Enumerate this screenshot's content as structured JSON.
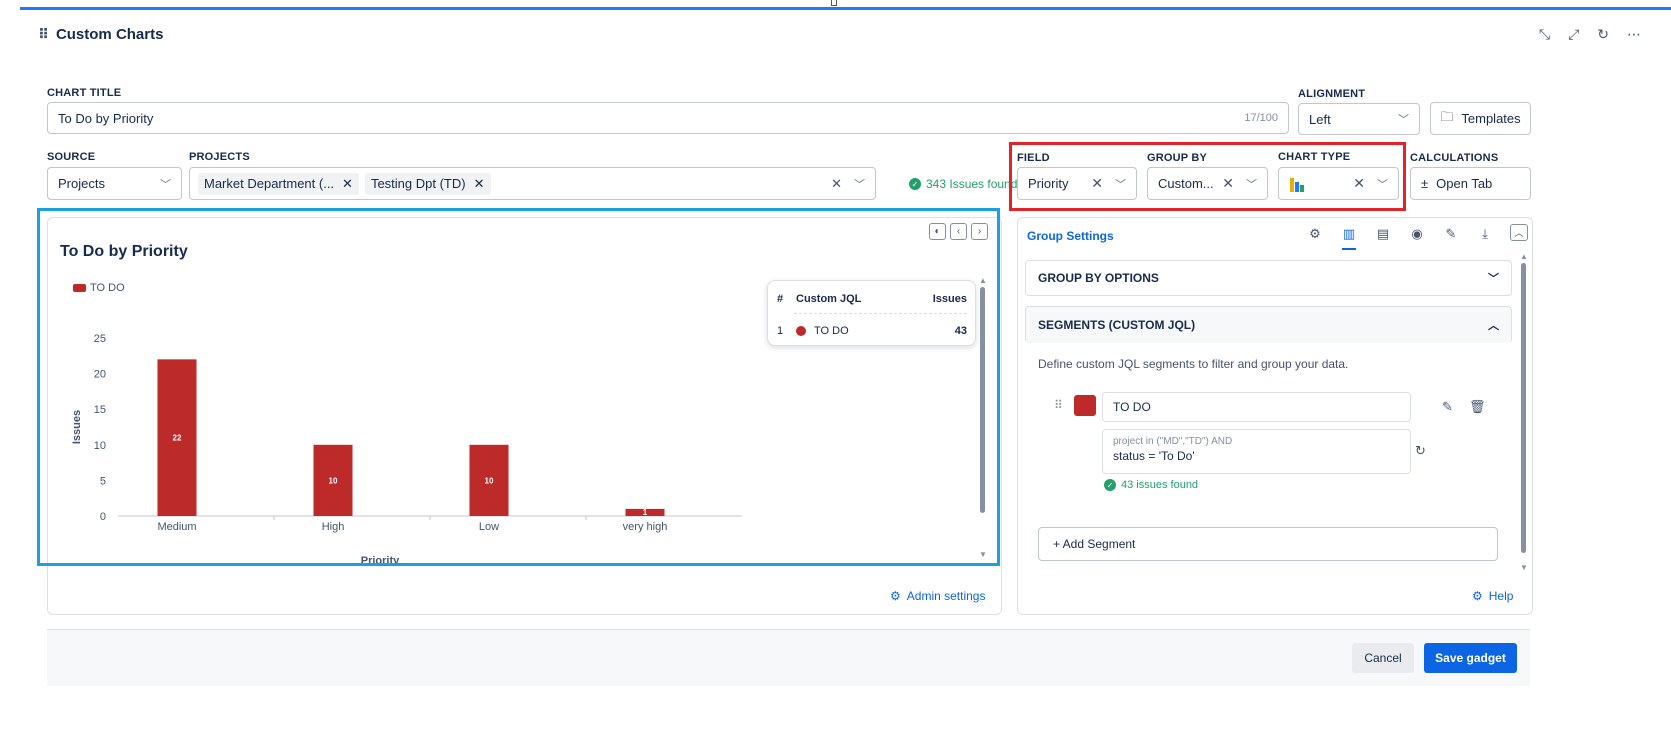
{
  "header": {
    "title": "Custom Charts"
  },
  "form": {
    "chart_title_label": "CHART TITLE",
    "chart_title_value": "To Do by Priority",
    "chart_title_counter": "17/100",
    "alignment_label": "ALIGNMENT",
    "alignment_value": "Left",
    "templates_label": "Templates",
    "source_label": "SOURCE",
    "source_value": "Projects",
    "projects_label": "PROJECTS",
    "project_tags": [
      "Market Department (...",
      "Testing Dpt (TD)"
    ],
    "issues_found": "343 Issues found",
    "field_label": "FIELD",
    "field_value": "Priority",
    "group_by_label": "GROUP BY",
    "group_by_value": "Custom...",
    "chart_type_label": "CHART TYPE",
    "calculations_label": "CALCULATIONS",
    "calculations_value": "Open Tab"
  },
  "chart_data": {
    "type": "bar",
    "title": "To Do by Priority",
    "categories": [
      "Medium",
      "High",
      "Low",
      "very high"
    ],
    "series": [
      {
        "name": "TO DO",
        "values": [
          22,
          10,
          10,
          1
        ],
        "color": "#bc2a2a"
      }
    ],
    "ylabel": "Issues",
    "xlabel": "Priority",
    "ylim": [
      0,
      25
    ],
    "yticks": [
      0,
      5,
      10,
      15,
      20,
      25
    ],
    "legend": "top-left"
  },
  "table_popup": {
    "headers": [
      "#",
      "Custom JQL",
      "Issues"
    ],
    "rows": [
      {
        "num": "1",
        "name": "TO DO",
        "count": "43"
      }
    ]
  },
  "admin_settings": "Admin settings",
  "panel": {
    "title": "Group Settings",
    "group_by_options": "GROUP BY OPTIONS",
    "segments_title": "SEGMENTS (CUSTOM JQL)",
    "segments_desc": "Define custom JQL segments to filter and group your data.",
    "segment": {
      "name": "TO DO",
      "jql_line1": "project in (\"MD\",\"TD\") AND",
      "jql_line2": "status = 'To Do'",
      "found": "43 issues found",
      "color": "#bc2a2a"
    },
    "add_segment": "+ Add Segment",
    "help": "Help"
  },
  "footer": {
    "cancel": "Cancel",
    "save": "Save gadget"
  },
  "colors": {
    "accent": "#0c66e4",
    "highlight_red": "#e2232a",
    "highlight_blue": "#1ba0e2",
    "success": "#22a06b"
  }
}
